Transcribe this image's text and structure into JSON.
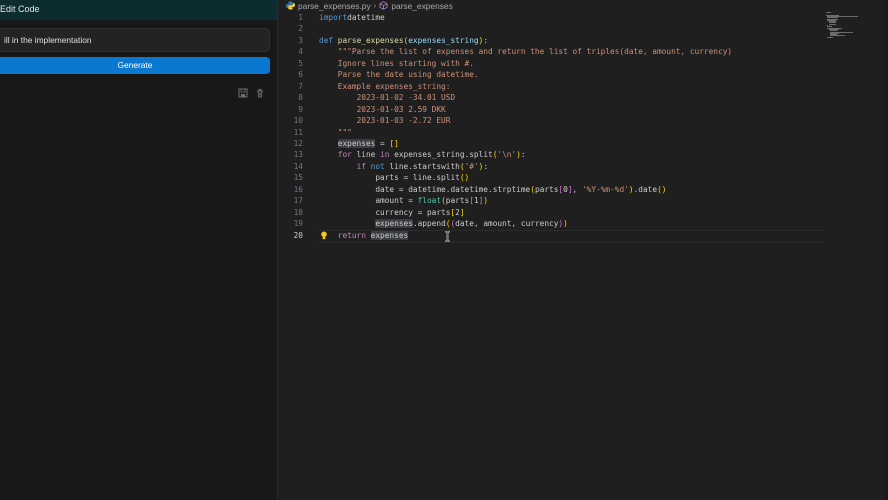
{
  "left_panel": {
    "title": "Edit Code",
    "prompt_value": "ill in the implementation",
    "generate_label": "Generate",
    "icons": [
      "save-icon",
      "trash-icon"
    ]
  },
  "editor": {
    "breadcrumb": {
      "file": "parse_expenses.py",
      "symbol": "parse_expenses"
    },
    "current_line": 20,
    "line_numbers": [
      "1",
      "2",
      "3",
      "4",
      "5",
      "6",
      "7",
      "8",
      "9",
      "10",
      "11",
      "12",
      "13",
      "14",
      "15",
      "16",
      "17",
      "18",
      "19",
      "20"
    ]
  },
  "code_lines": [
    [
      [
        "kw",
        "import"
      ],
      [
        "",
        "datetime"
      ]
    ],
    [],
    [
      [
        "kw",
        "def"
      ],
      [
        "",
        " "
      ],
      [
        "fn",
        "parse_expenses"
      ],
      [
        "br1",
        "("
      ],
      [
        "param",
        "expenses_string"
      ],
      [
        "br1",
        ")"
      ],
      [
        "",
        ":"
      ]
    ],
    [
      [
        "",
        "    "
      ],
      [
        "str",
        "\"\"\"Parse the list of expenses and return the list of triples(date, amount, currency)"
      ]
    ],
    [
      [
        "",
        "    "
      ],
      [
        "str",
        "Ignore lines starting with #."
      ]
    ],
    [
      [
        "",
        "    "
      ],
      [
        "str",
        "Parse the date using datetime."
      ]
    ],
    [
      [
        "",
        "    "
      ],
      [
        "str",
        "Example expenses_string:"
      ]
    ],
    [
      [
        "",
        "        "
      ],
      [
        "str",
        "2023-01-02 -34.01 USD"
      ]
    ],
    [
      [
        "",
        "        "
      ],
      [
        "str",
        "2023-01-03 2.59 DKK"
      ]
    ],
    [
      [
        "",
        "        "
      ],
      [
        "str",
        "2023-01-03 -2.72 EUR"
      ]
    ],
    [
      [
        "",
        "    "
      ],
      [
        "str",
        "\"\"\""
      ]
    ],
    [
      [
        "",
        "    "
      ],
      [
        "hl",
        "expenses"
      ],
      [
        "",
        " = "
      ],
      [
        "br1",
        "[]"
      ]
    ],
    [
      [
        "",
        "    "
      ],
      [
        "ctrl",
        "for"
      ],
      [
        "",
        " line "
      ],
      [
        "ctrl",
        "in"
      ],
      [
        "",
        " expenses_string.split"
      ],
      [
        "br1",
        "("
      ],
      [
        "str",
        "'\\n'"
      ],
      [
        "br1",
        ")"
      ],
      [
        "",
        ":"
      ]
    ],
    [
      [
        "",
        "        "
      ],
      [
        "ctrl",
        "if"
      ],
      [
        "",
        " "
      ],
      [
        "kw",
        "not"
      ],
      [
        "",
        " line.startswith"
      ],
      [
        "br1",
        "("
      ],
      [
        "str",
        "'#'"
      ],
      [
        "br1",
        ")"
      ],
      [
        "",
        ":"
      ]
    ],
    [
      [
        "",
        "            "
      ],
      [
        "",
        "parts = line.split"
      ],
      [
        "br1",
        "()"
      ]
    ],
    [
      [
        "",
        "            "
      ],
      [
        "",
        "date = datetime.datetime.strptime"
      ],
      [
        "br1",
        "("
      ],
      [
        "",
        "parts"
      ],
      [
        "br2",
        "["
      ],
      [
        "",
        "0"
      ],
      [
        "br2",
        "]"
      ],
      [
        "",
        ", "
      ],
      [
        "str",
        "'%Y-%m-%d'"
      ],
      [
        "br1",
        ")"
      ],
      [
        "",
        ".date"
      ],
      [
        "br1",
        "()"
      ]
    ],
    [
      [
        "",
        "            "
      ],
      [
        "",
        "amount = "
      ],
      [
        "cls",
        "float"
      ],
      [
        "br1",
        "("
      ],
      [
        "",
        "parts"
      ],
      [
        "br2",
        "["
      ],
      [
        "",
        "1"
      ],
      [
        "br2",
        "]"
      ],
      [
        "br1",
        ")"
      ]
    ],
    [
      [
        "",
        "            "
      ],
      [
        "",
        "currency = parts"
      ],
      [
        "br1",
        "["
      ],
      [
        "",
        "2"
      ],
      [
        "br1",
        "]"
      ]
    ],
    [
      [
        "",
        "            "
      ],
      [
        "hl",
        "expenses"
      ],
      [
        "",
        ".append"
      ],
      [
        "br1",
        "("
      ],
      [
        "br2",
        "("
      ],
      [
        "",
        "date, amount, currency"
      ],
      [
        "br2",
        ")"
      ],
      [
        "br1",
        ")"
      ]
    ],
    [
      [
        "",
        "    "
      ],
      [
        "ctrl",
        "return"
      ],
      [
        "",
        " "
      ],
      [
        "hl",
        "expenses"
      ]
    ]
  ]
}
